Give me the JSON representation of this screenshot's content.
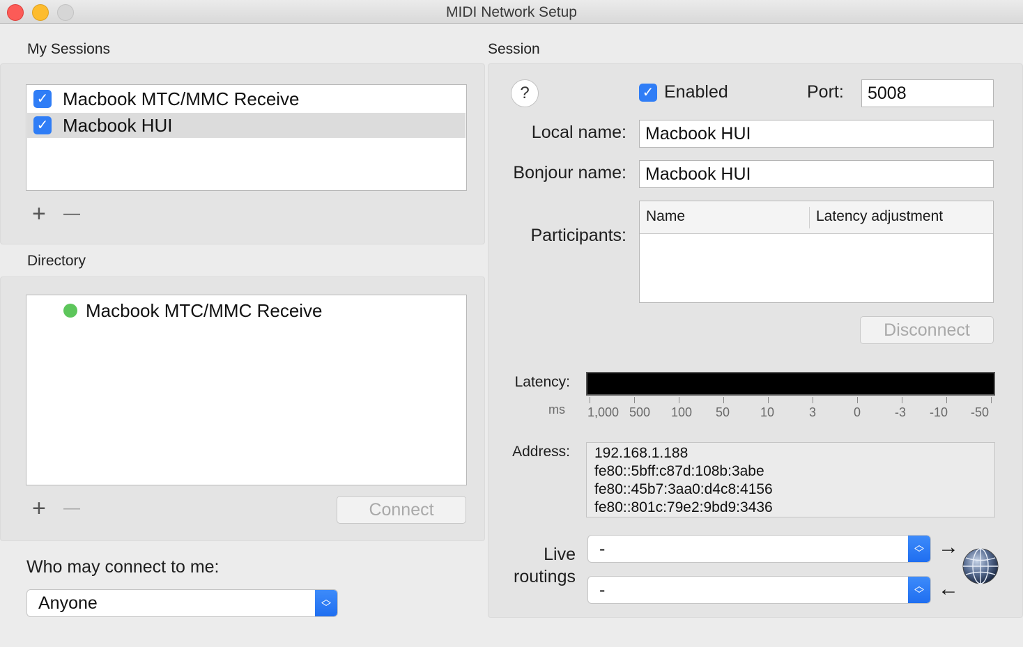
{
  "window": {
    "title": "MIDI Network Setup"
  },
  "my_sessions": {
    "label": "My Sessions",
    "items": [
      {
        "label": "Macbook MTC/MMC Receive",
        "checked": true,
        "selected": false
      },
      {
        "label": "Macbook HUI",
        "checked": true,
        "selected": true
      }
    ],
    "add_label": "+",
    "remove_label": "—"
  },
  "directory": {
    "label": "Directory",
    "items": [
      {
        "label": "Macbook MTC/MMC Receive",
        "status_color": "#5dc65b"
      }
    ],
    "add_label": "+",
    "remove_label": "—",
    "connect_label": "Connect"
  },
  "who_may_connect": {
    "label": "Who may connect to me:",
    "value": "Anyone"
  },
  "session": {
    "label": "Session",
    "help_label": "?",
    "enabled_label": "Enabled",
    "enabled": true,
    "port_label": "Port:",
    "port_value": "5008",
    "local_name_label": "Local name:",
    "local_name_value": "Macbook HUI",
    "bonjour_name_label": "Bonjour name:",
    "bonjour_name_value": "Macbook HUI",
    "participants_label": "Participants:",
    "participants_columns": [
      "Name",
      "Latency adjustment"
    ],
    "disconnect_label": "Disconnect",
    "latency_label": "Latency:",
    "latency_unit": "ms",
    "latency_ticks": [
      "1,000",
      "500",
      "100",
      "50",
      "10",
      "3",
      "0",
      "-3",
      "-10",
      "-50"
    ],
    "address_label": "Address:",
    "addresses": [
      "192.168.1.188",
      "fe80::5bff:c87d:108b:3abe",
      "fe80::45b7:3aa0:d4c8:4156",
      "fe80::801c:79e2:9bd9:3436"
    ],
    "live_routings_label_1": "Live",
    "live_routings_label_2": "routings",
    "routing_in_value": "-",
    "routing_out_value": "-",
    "network_icon": "globe-network-icon"
  },
  "colors": {
    "accent": "#2f7df6",
    "status_online": "#5dc65b"
  }
}
